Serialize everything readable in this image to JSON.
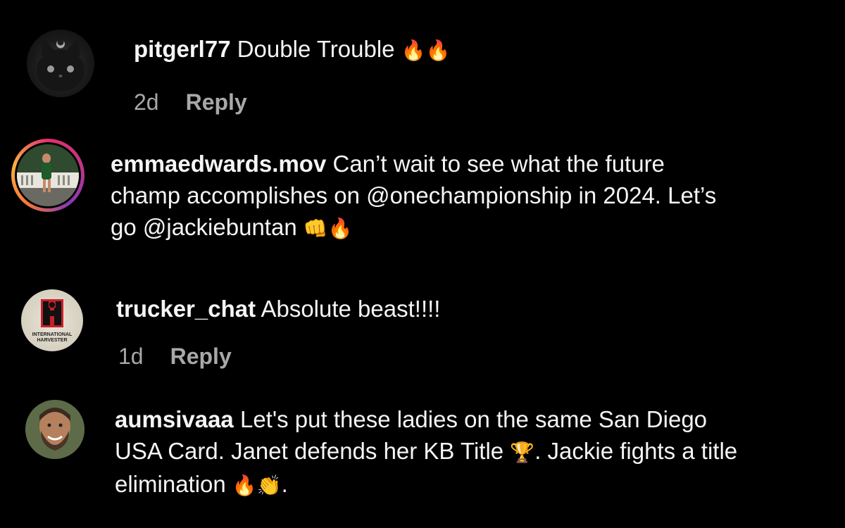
{
  "comments": [
    {
      "username": "pitgerl77",
      "text": "Double Trouble",
      "emojis": "🔥🔥",
      "time": "2d",
      "reply_label": "Reply",
      "avatar_icon": "black-cat-avatar"
    },
    {
      "username": "emmaedwards.mov",
      "text_line1": "Can’t wait to see what the future",
      "text_line2": "champ accomplishes on @onechampionship in 2024. Let’s",
      "text_line3": "go @jackiebuntan",
      "emojis": "👊🔥",
      "avatar_icon": "story-ring-avatar"
    },
    {
      "username": "trucker_chat",
      "text": "Absolute beast!!!!",
      "time": "1d",
      "reply_label": "Reply",
      "avatar_icon": "international-harvester-logo-avatar",
      "avatar_text_line1": "INTERNATIONAL",
      "avatar_text_line2": "HARVESTER"
    },
    {
      "username": "aumsivaaa",
      "text_line1": "Let's put these ladies on the same San Diego",
      "text_line2a": "USA Card. Janet defends her KB Title",
      "emoji_trophy": "🏆",
      "text_line2b": ". Jackie fights a title",
      "text_line3": "elimination",
      "emojis": "🔥👏",
      "text_line3_end": ".",
      "avatar_icon": "bearded-man-avatar"
    }
  ],
  "colors": {
    "background": "#000000",
    "text": "#f5f5f5",
    "meta": "#a8a8a8"
  }
}
